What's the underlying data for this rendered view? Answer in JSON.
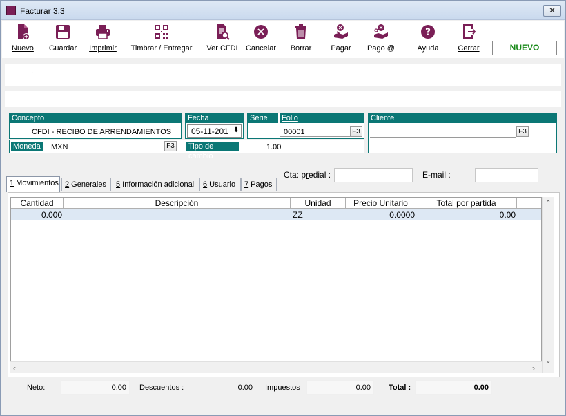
{
  "window": {
    "title": "Facturar 3.3",
    "close_symbol": "✕"
  },
  "toolbar": {
    "items": [
      {
        "key": "nuevo",
        "label": "Nuevo",
        "icon": "new-document-icon"
      },
      {
        "key": "guardar",
        "label": "Guardar",
        "icon": "floppy-save-icon"
      },
      {
        "key": "imprimir",
        "label": "Imprimir",
        "icon": "printer-icon"
      },
      {
        "key": "timbrar",
        "label": "Timbrar / Entregar",
        "icon": "qr-code-icon"
      },
      {
        "key": "vercfdi",
        "label": "Ver CFDI",
        "icon": "view-document-icon"
      },
      {
        "key": "cancelar",
        "label": "Cancelar",
        "icon": "cancel-x-icon"
      },
      {
        "key": "borrar",
        "label": "Borrar",
        "icon": "trash-icon"
      },
      {
        "key": "pagar",
        "label": "Pagar",
        "icon": "pay-hand-icon"
      },
      {
        "key": "pagoat",
        "label": "Pago @",
        "icon": "pay-online-icon"
      },
      {
        "key": "ayuda",
        "label": "Ayuda",
        "icon": "help-question-icon"
      },
      {
        "key": "cerrar",
        "label": "Cerrar",
        "icon": "exit-door-icon"
      }
    ],
    "status": "NUEVO"
  },
  "band": {
    "dot": "."
  },
  "concepto": {
    "header": "Concepto",
    "value": "CFDI - RECIBO DE ARRENDAMIENTOS"
  },
  "fecha": {
    "header": "Fecha",
    "value": "05-11-201",
    "picker_symbol": "⬇"
  },
  "serie": {
    "header": "Serie",
    "value": ""
  },
  "folio": {
    "header": "Folio",
    "value": "00001",
    "f3": "F3"
  },
  "cliente": {
    "header": "Cliente",
    "value": "",
    "f3": "F3"
  },
  "moneda": {
    "label": "Moneda",
    "value": "MXN",
    "f3": "F3"
  },
  "tipo_cambio": {
    "label": "Tipo de cambio",
    "value": "1.00"
  },
  "tabs": [
    {
      "num": "1",
      "label": " Movimientos"
    },
    {
      "num": "2",
      "label": " Generales"
    },
    {
      "num": "5",
      "label": " Información adicional"
    },
    {
      "num": "6",
      "label": " Usuario"
    },
    {
      "num": "7",
      "label": " Pagos"
    }
  ],
  "cta_predial": {
    "label_pre": "Cta: p",
    "label_u": "r",
    "label_post": "edial :",
    "value": ""
  },
  "email": {
    "label": "E-mail :",
    "value": ""
  },
  "grid": {
    "columns": [
      "Cantidad",
      "Descripción",
      "Unidad",
      "Precio Unitario",
      "Total por partida"
    ],
    "rows": [
      {
        "cantidad": "0.000",
        "descripcion": "",
        "unidad": "ZZ",
        "precio": "0.0000",
        "total": "0.00"
      }
    ]
  },
  "totals": {
    "neto": {
      "label": "Neto:",
      "value": "0.00"
    },
    "descuentos": {
      "label": "Descuentos :",
      "value": "0.00"
    },
    "impuestos": {
      "label": "Impuestos",
      "value": "0.00"
    },
    "total": {
      "label": "Total :",
      "value": "0.00"
    }
  },
  "colors": {
    "accent": "#0b7775",
    "brand": "#7a1e56",
    "status": "#1a8a1a"
  }
}
